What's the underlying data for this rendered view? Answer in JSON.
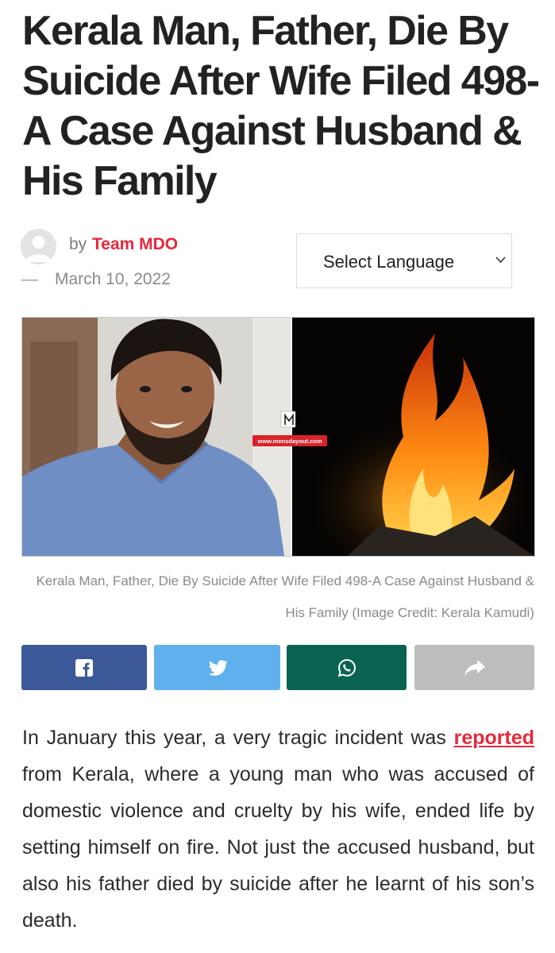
{
  "article": {
    "title": "Kerala Man, Father, Die By Suicide After Wife Filed 498-A Case Against Husband & His Family",
    "meta": {
      "by_label": "by",
      "author": "Team MDO",
      "date_prefix": "—",
      "date": "March 10, 2022"
    },
    "language_select": {
      "selected": "Select Language",
      "icon": "chevron-down-icon"
    },
    "image": {
      "watermark_url": "www.mensdayout.com"
    },
    "caption": "Kerala Man, Father, Die By Suicide After Wife Filed 498-A Case Against Husband & His Family (Image Credit: Kerala Kamudi)",
    "share_buttons": [
      {
        "icon": "facebook-icon",
        "color": "#3b5998"
      },
      {
        "icon": "twitter-icon",
        "color": "#5fb0ec"
      },
      {
        "icon": "whatsapp-icon",
        "color": "#0a6350"
      },
      {
        "icon": "share-icon",
        "color": "#bdbdbd"
      }
    ],
    "body": {
      "before_link": "In January this year, a very tragic incident was",
      "link_text": "reported",
      "after_link": "from Kerala, where a young man who was accused of domestic violence and cruelty by his wife, ended life by setting himself on fire. Not just the accused husband, but also his father died by suicide after he learnt of his son’s death."
    }
  },
  "colors": {
    "accent": "#e8273b",
    "text": "#222222",
    "muted": "#8a8a8a"
  }
}
